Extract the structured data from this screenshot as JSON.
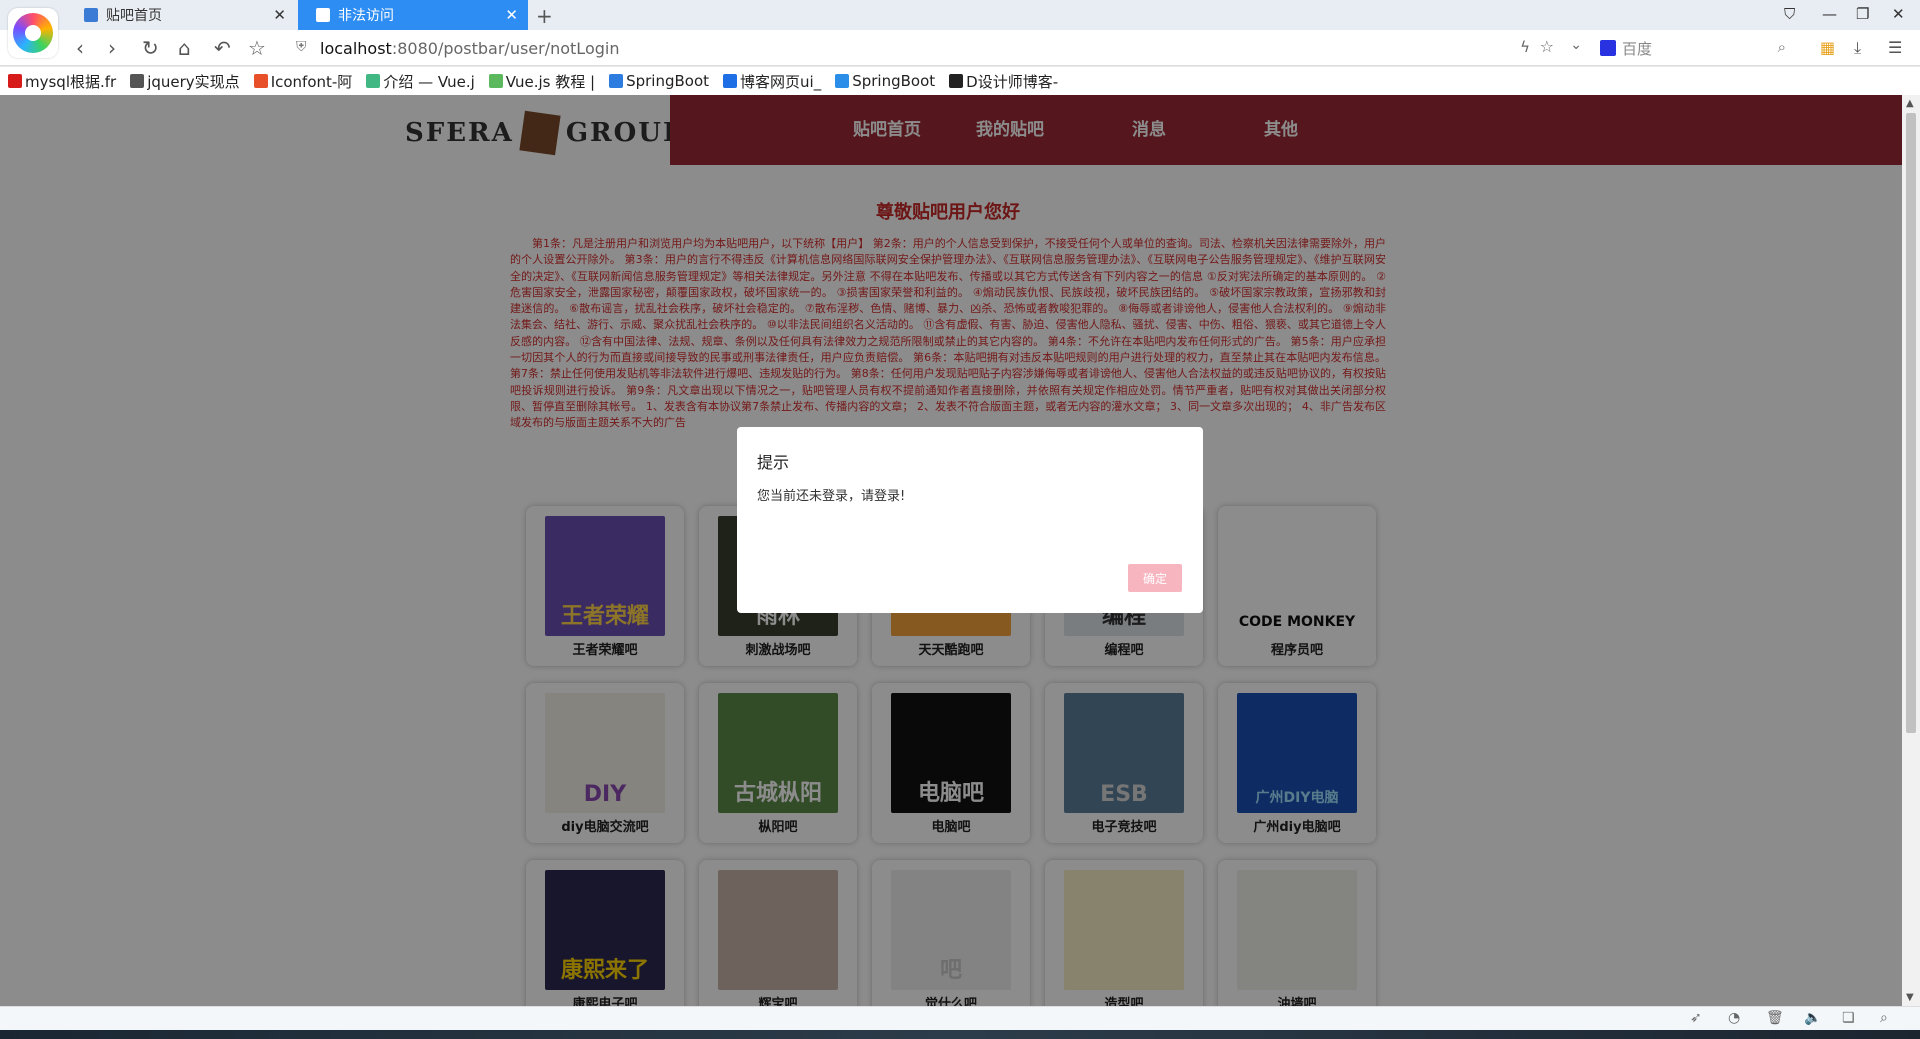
{
  "browser": {
    "tabs": [
      {
        "title": "贴吧首页",
        "active": false
      },
      {
        "title": "非法访问",
        "active": true
      }
    ],
    "new_tab": "+",
    "url_host": "localhost",
    "url_path": ":8080/postbar/user/notLogin",
    "search_placeholder": "百度",
    "bookmarks": [
      {
        "label": "mysql根据.fr",
        "icon_color": "#d71b1b"
      },
      {
        "label": "jquery实现点",
        "icon_color": "#555555"
      },
      {
        "label": "Iconfont-阿",
        "icon_color": "#e8502a"
      },
      {
        "label": "介绍 — Vue.j",
        "icon_color": "#41b883"
      },
      {
        "label": "Vue.js 教程 |",
        "icon_color": "#5cb85c"
      },
      {
        "label": "SpringBoot",
        "icon_color": "#2d7de0"
      },
      {
        "label": "博客网页ui_",
        "icon_color": "#1e6fe6"
      },
      {
        "label": "SpringBoot",
        "icon_color": "#2a8ee8"
      },
      {
        "label": "D设计师博客-",
        "icon_color": "#222222"
      }
    ]
  },
  "site": {
    "logo_left": "SFERA",
    "logo_right": "GROUP",
    "nav": [
      "贴吧首页",
      "我的贴吧",
      "消息",
      "其他"
    ],
    "accent_color": "#9b2b36"
  },
  "notice": {
    "title": "尊敬贴吧用户您好",
    "text": "第1条：凡是注册用户和浏览用户均为本贴吧用户，以下统称【用户】 第2条：用户的个人信息受到保护，不接受任何个人或单位的查询。司法、检察机关因法律需要除外，用户的个人设置公开除外。 第3条：用户的言行不得违反《计算机信息网络国际联网安全保护管理办法》、《互联网信息服务管理办法》、《互联网电子公告服务管理规定》、《维护互联网安全的决定》、《互联网新闻信息服务管理规定》等相关法律规定。另外注意 不得在本贴吧发布、传播或以其它方式传送含有下列内容之一的信息 ①反对宪法所确定的基本原则的。 ②危害国家安全，泄露国家秘密，颠覆国家政权，破坏国家统一的。 ③损害国家荣誉和利益的。 ④煽动民族仇恨、民族歧视，破坏民族团结的。 ⑤破坏国家宗教政策，宣扬邪教和封建迷信的。 ⑥散布谣言，扰乱社会秩序，破坏社会稳定的。 ⑦散布淫秽、色情、赌博、暴力、凶杀、恐怖或者教唆犯罪的。 ⑧侮辱或者诽谤他人，侵害他人合法权利的。 ⑨煽动非法集会、结社、游行、示威、聚众扰乱社会秩序的。 ⑩以非法民间组织名义活动的。 ⑪含有虚假、有害、胁迫、侵害他人隐私、骚扰、侵害、中伤、粗俗、猥亵、或其它道德上令人反感的内容。 ⑫含有中国法律、法规、规章、条例以及任何具有法律效力之规范所限制或禁止的其它内容的。 第4条：不允许在本贴吧内发布任何形式的广告。 第5条：用户应承担一切因其个人的行为而直接或间接导致的民事或刑事法律责任，用户应负责赔偿。 第6条：本贴吧拥有对违反本贴吧规则的用户进行处理的权力，直至禁止其在本贴吧内发布信息。 第7条：禁止任何使用发贴机等非法软件进行爆吧、违规发贴的行为。 第8条：任何用户发现贴吧贴子内容涉嫌侮辱或者诽谤他人、侵害他人合法权益的或违反贴吧协议的，有权按贴吧投诉规则进行投诉。 第9条：凡文章出现以下情况之一，贴吧管理人员有权不提前通知作者直接删除，并依照有关规定作相应处罚。情节严重者，贴吧有权对其做出关闭部分权限、暂停直至删除其帐号。 1、发表含有本协议第7条禁止发布、传播内容的文章； 2、发表不符合版面主题，或者无内容的灌水文章； 3、同一文章多次出现的； 4、非广告发布区域发布的与版面主题关系不大的广告"
  },
  "bars": [
    {
      "name": "王者荣耀吧",
      "img_text": "王者荣耀",
      "bg": "#6a4fb3",
      "fg": "#ffd54a"
    },
    {
      "name": "刺激战场吧",
      "img_text": "雨林",
      "bg": "#3a3f2d",
      "fg": "#ffffff"
    },
    {
      "name": "天天酷跑吧",
      "img_text": "",
      "bg": "#f2a23a",
      "fg": "#ffffff"
    },
    {
      "name": "编程吧",
      "img_text": "编程",
      "bg": "#dde3ea",
      "fg": "#333333"
    },
    {
      "name": "程序员吧",
      "img_text": "CODE MONKEY",
      "bg": "#ffffff",
      "fg": "#111111"
    },
    {
      "name": "diy电脑交流吧",
      "img_text": "DIY",
      "bg": "#f3f0e6",
      "fg": "#8a4ab0"
    },
    {
      "name": "枞阳吧",
      "img_text": "古城枞阳",
      "bg": "#5c8a4a",
      "fg": "#ffffff"
    },
    {
      "name": "电脑吧",
      "img_text": "电脑吧",
      "bg": "#111111",
      "fg": "#ffffff"
    },
    {
      "name": "电子竞技吧",
      "img_text": "ESB",
      "bg": "#5a7e9a",
      "fg": "#d8d8d8"
    },
    {
      "name": "广州diy电脑吧",
      "img_text": "广州DIY电脑",
      "bg": "#1b4fb5",
      "fg": "#9fe3ff"
    },
    {
      "name": "康熙电子吧",
      "img_text": "康熙来了",
      "bg": "#2d2850",
      "fg": "#ffd400"
    },
    {
      "name": "辉宝吧",
      "img_text": "",
      "bg": "#c9b3a8",
      "fg": "#ffffff"
    },
    {
      "name": "觉什么吧",
      "img_text": "吧",
      "bg": "#eeeeee",
      "fg": "#c8c8c8"
    },
    {
      "name": "造型吧",
      "img_text": "",
      "bg": "#f6eec5",
      "fg": "#333333"
    },
    {
      "name": "油墙吧",
      "img_text": "",
      "bg": "#f0f0ea",
      "fg": "#333333"
    }
  ],
  "modal": {
    "title": "提示",
    "message": "您当前还未登录，请登录!",
    "confirm": "确定"
  }
}
